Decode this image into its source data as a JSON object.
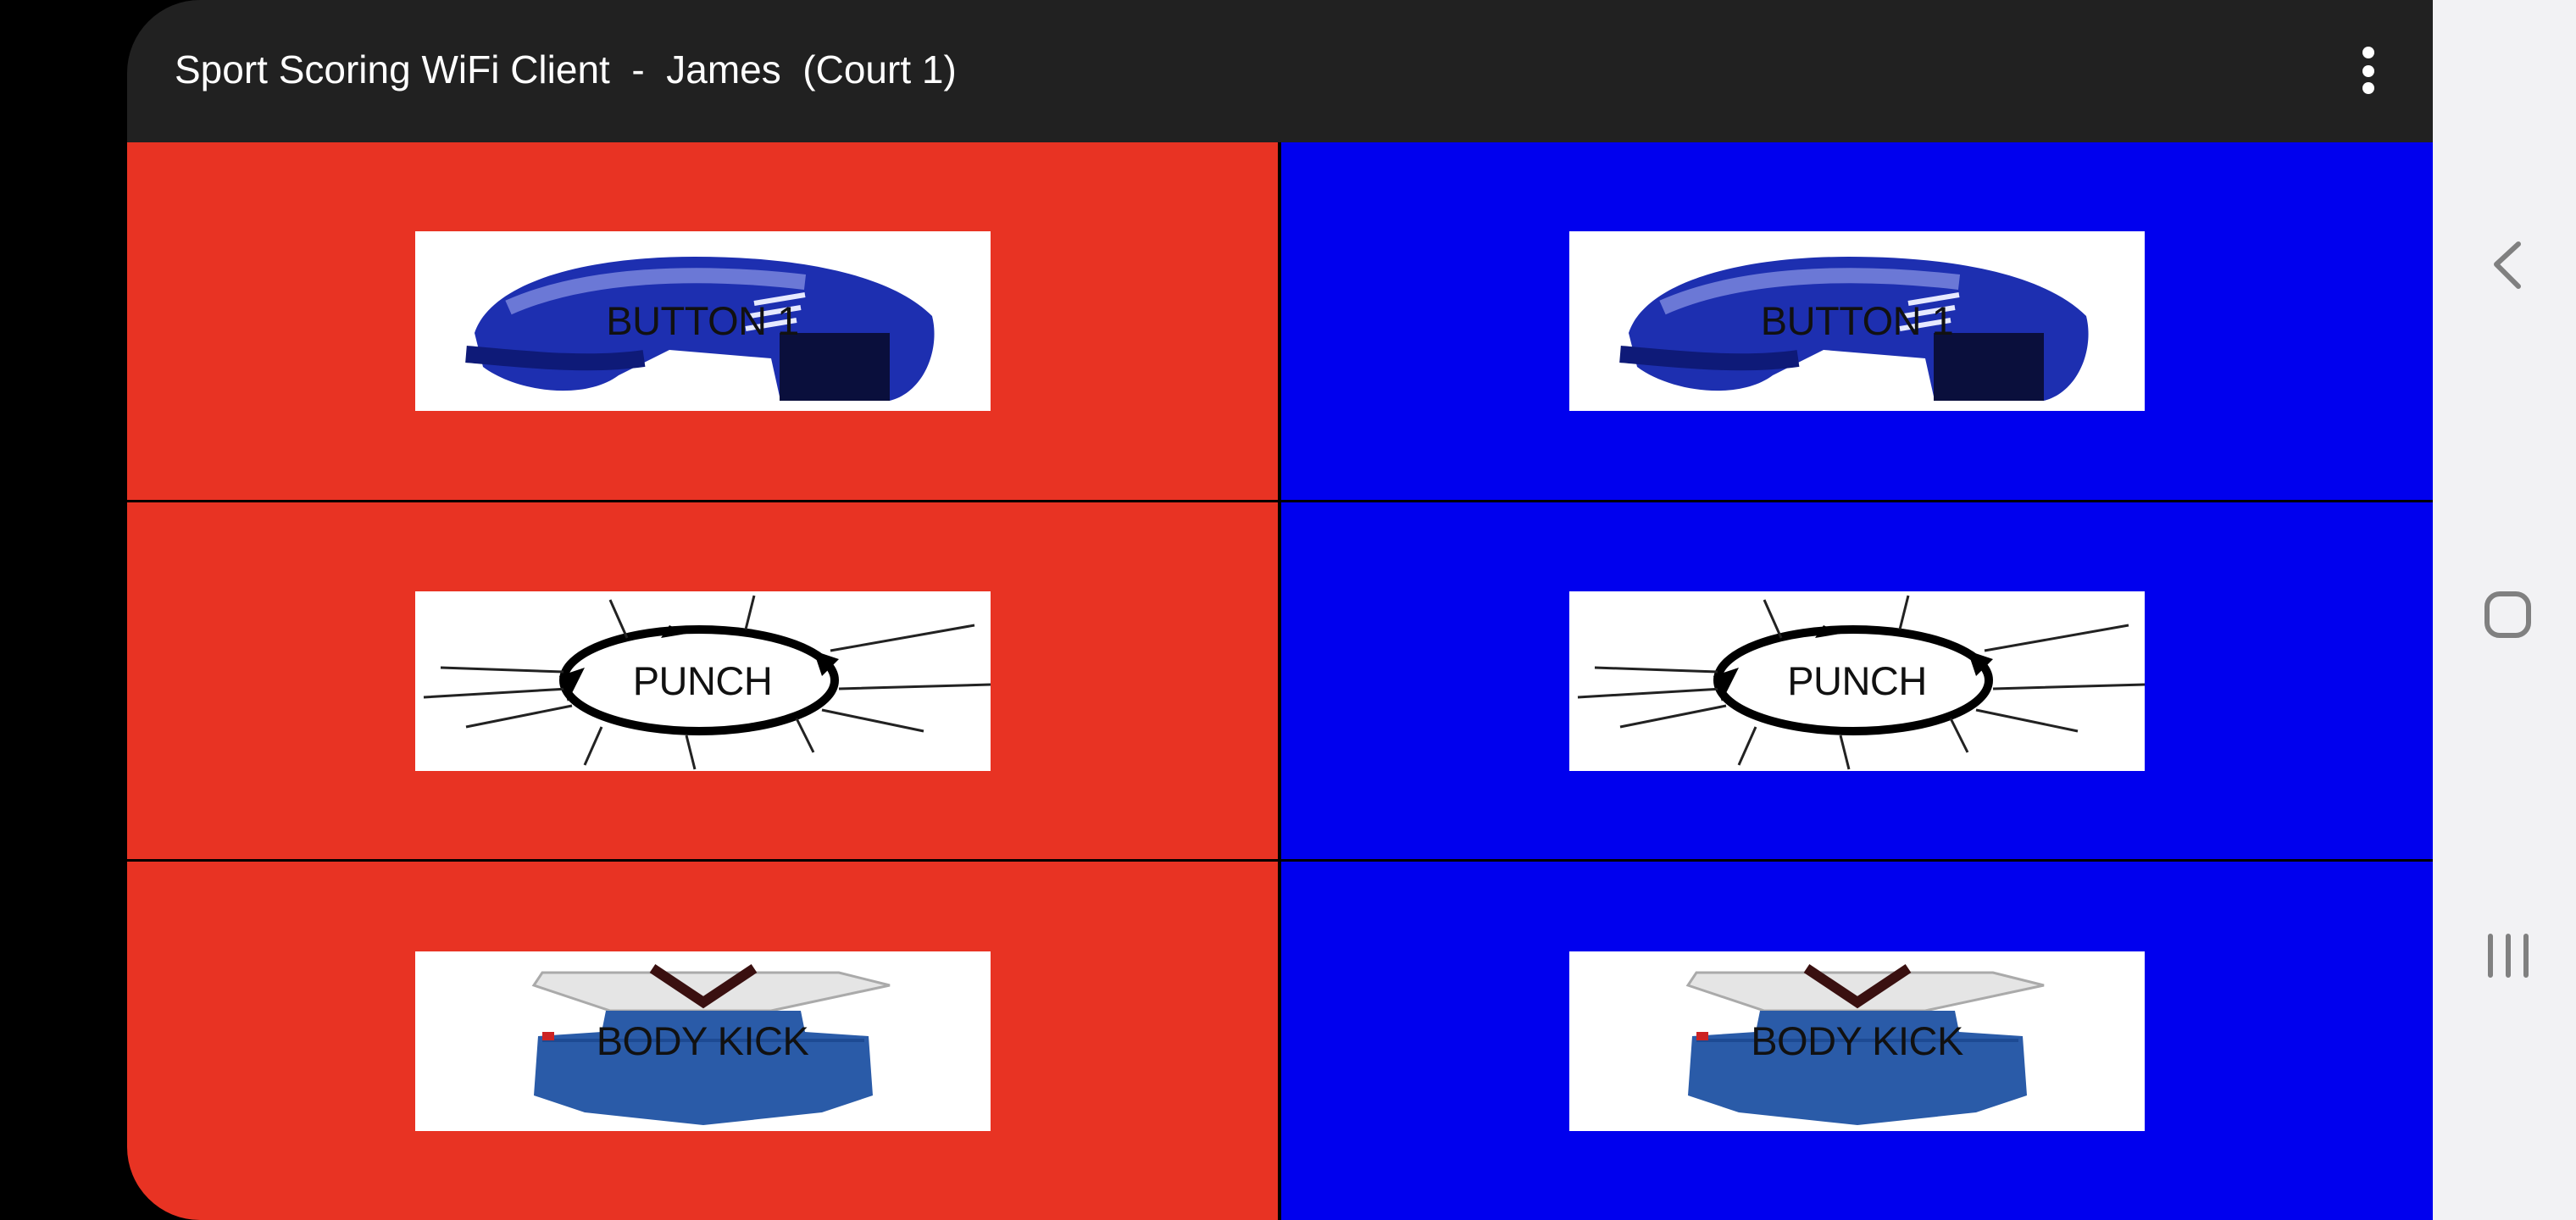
{
  "app": {
    "title": "Sport Scoring WiFi Client  -  James  (Court 1)",
    "overflow_icon": "more-vert-icon"
  },
  "colors": {
    "appbar": "#212121",
    "red_side": "#e83323",
    "blue_side": "#0000ee",
    "navbar": "#f2f2f4",
    "nav_icon": "#808080"
  },
  "scoring": {
    "red": [
      {
        "label": "BUTTON 1",
        "icon": "helmet-icon"
      },
      {
        "label": "PUNCH",
        "icon": "punch-crack-icon"
      },
      {
        "label": "BODY KICK",
        "icon": "body-protector-icon"
      }
    ],
    "blue": [
      {
        "label": "BUTTON 1",
        "icon": "helmet-icon"
      },
      {
        "label": "PUNCH",
        "icon": "punch-crack-icon"
      },
      {
        "label": "BODY KICK",
        "icon": "body-protector-icon"
      }
    ]
  },
  "navbar": {
    "back": "back-icon",
    "home": "home-icon",
    "recents": "recents-icon"
  }
}
